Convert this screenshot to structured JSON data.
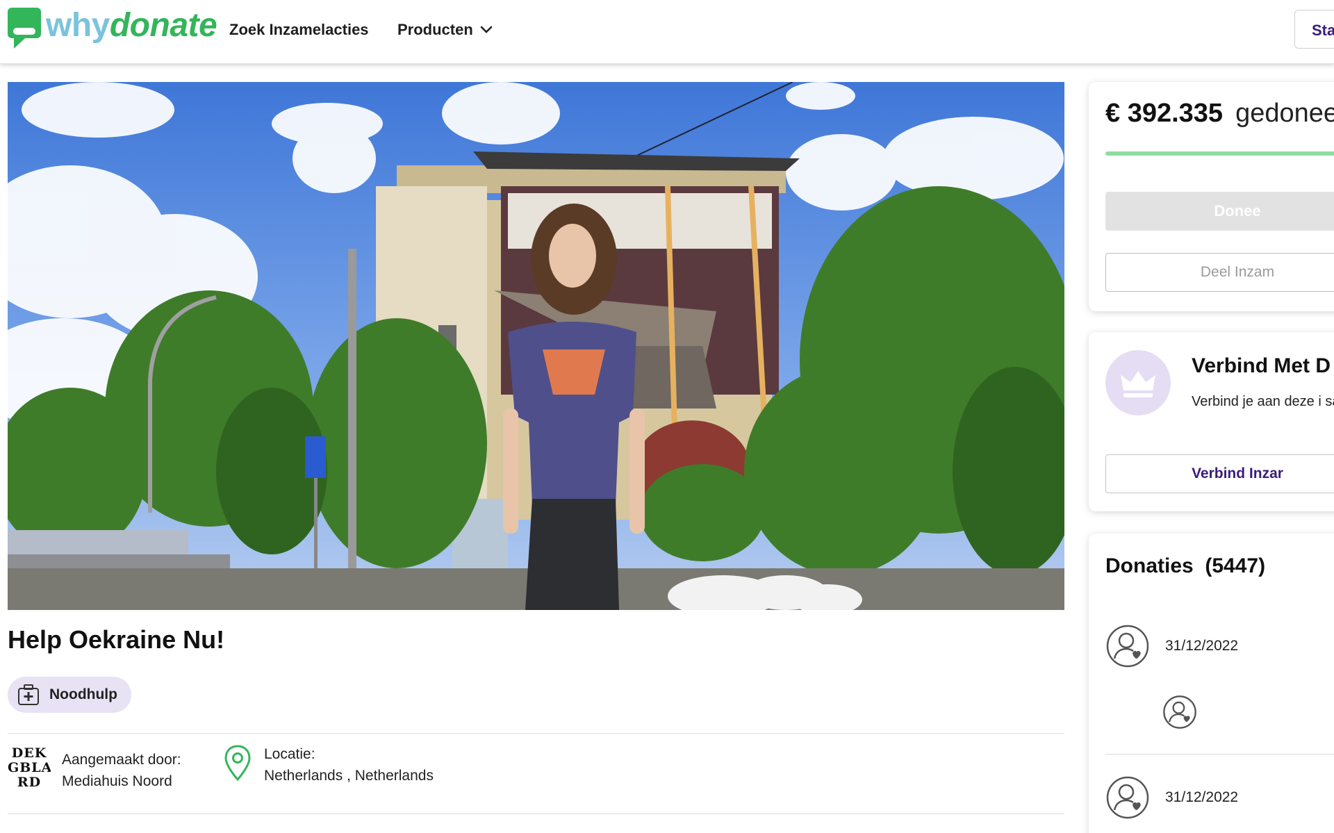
{
  "header": {
    "logo_part1": "why",
    "logo_part2": "donate",
    "nav_search": "Zoek Inzamelacties",
    "nav_products": "Producten",
    "start_button": "Sta"
  },
  "campaign": {
    "title": "Help Oekraine Nu!",
    "category": "Noodhulp",
    "creator_label": "Aangemaakt door:",
    "creator_name": "Mediahuis Noord",
    "creator_logo_lines": [
      "DEK",
      "GBLA",
      "RD"
    ],
    "location_label": "Locatie:",
    "location_value": "Netherlands , Netherlands"
  },
  "summary": {
    "amount": "€ 392.335",
    "amount_label": "gedonee",
    "donate_button": "Donee",
    "share_button": "Deel Inzam"
  },
  "connect": {
    "title": "Verbind Met D",
    "description": "Verbind je aan deze i samen.",
    "button": "Verbind Inzar"
  },
  "donations": {
    "title": "Donaties",
    "count": "(5447)",
    "items": [
      {
        "date": "31/12/2022"
      },
      {
        "date": "31/12/2022"
      }
    ]
  },
  "colors": {
    "brand_green": "#33b55a",
    "brand_blue": "#7bc3dc",
    "accent_purple": "#3a1d7a",
    "tag_bg": "#e7e2f4"
  }
}
